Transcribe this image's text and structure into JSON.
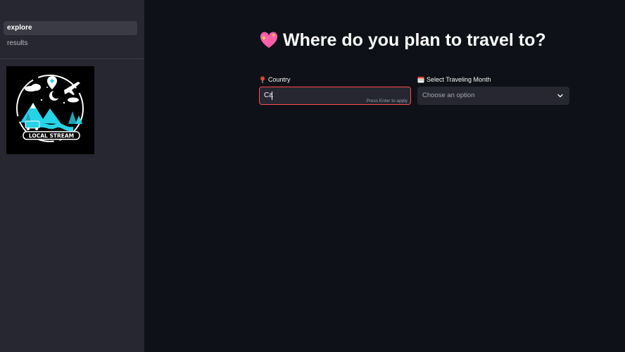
{
  "sidebar": {
    "nav": [
      {
        "label": "explore",
        "active": true
      },
      {
        "label": "results",
        "active": false
      }
    ],
    "logo": {
      "text": "LOCAL STREAM",
      "icon": "travel-logo"
    }
  },
  "main": {
    "title": "Where do you plan to travel to?",
    "title_icon": "sparkling-heart-icon",
    "country": {
      "label": "Country",
      "icon": "round-pushpin-icon",
      "value": "Ca",
      "hint": "Press Enter to apply"
    },
    "month": {
      "label": "Select Traveling Month",
      "icon": "calendar-icon",
      "placeholder": "Choose an option"
    }
  },
  "colors": {
    "background": "#0e1117",
    "sidebar": "#262730",
    "accent": "#ff4b4b",
    "logo_cyan": "#27d3e6"
  }
}
